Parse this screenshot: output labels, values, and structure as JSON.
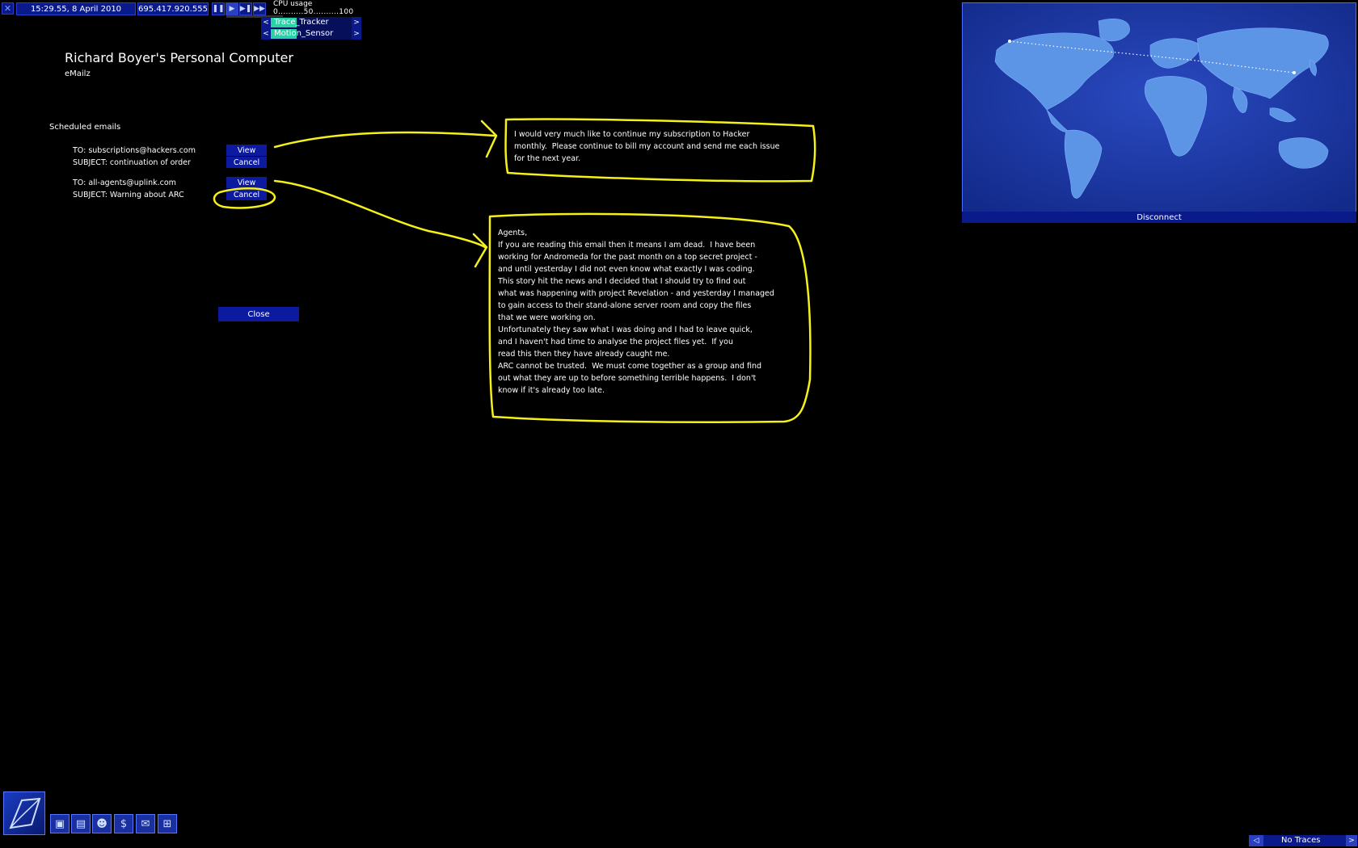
{
  "topbar": {
    "close_icon": "close-icon",
    "datetime": "15:29.55, 8 April 2010",
    "ip": "695.417.920.555",
    "speed_buttons": [
      "pause-icon",
      "play-icon",
      "fast-forward-icon",
      "fastest-forward-icon"
    ],
    "cpu": {
      "label": "CPU usage",
      "scale": "0..........50..........100"
    },
    "gadgets": [
      {
        "name": "Trace_Tracker",
        "prev": "<",
        "next": ">",
        "fill_fraction": 0.32
      },
      {
        "name": "Motion_Sensor",
        "prev": "<",
        "next": ">",
        "fill_fraction": 0.32
      }
    ]
  },
  "screen": {
    "title": "Richard Boyer's Personal Computer",
    "subtitle": "eMailz",
    "scheduled_label": "Scheduled emails",
    "emails": [
      {
        "to": "TO: subscriptions@hackers.com",
        "subject": "SUBJECT: continuation of order",
        "view": "View",
        "cancel": "Cancel"
      },
      {
        "to": "TO: all-agents@uplink.com",
        "subject": "SUBJECT: Warning about ARC",
        "view": "View",
        "cancel": "Cancel"
      }
    ],
    "close_label": "Close"
  },
  "popups": {
    "first": "I would very much like to continue my subscription to Hacker\nmonthly.  Please continue to bill my account and send me each issue\nfor the next year.",
    "second": "Agents,\nIf you are reading this email then it means I am dead.  I have been\nworking for Andromeda for the past month on a top secret project -\nand until yesterday I did not even know what exactly I was coding.\nThis story hit the news and I decided that I should try to find out\nwhat was happening with project Revelation - and yesterday I managed\nto gain access to their stand-alone server room and copy the files\nthat we were working on.\nUnfortunately they saw what I was doing and I had to leave quick,\nand I haven't had time to analyse the project files yet.  If you\nread this then they have already caught me.\nARC cannot be trusted.  We must come together as a group and find\nout what they are up to before something terrible happens.  I don't\nknow if it's already too late."
  },
  "map": {
    "disconnect_label": "Disconnect"
  },
  "bottom": {
    "tools": [
      "computer-icon",
      "storage-icon",
      "agent-icon",
      "finance-icon",
      "email-icon",
      "network-icon"
    ],
    "traces": {
      "label": "No Traces",
      "prev": "◁",
      "next": ">"
    }
  },
  "colors": {
    "accent": "#0c1aa0",
    "annotation": "#f5f01a",
    "map_sea": "#1f3aa8",
    "map_land": "#5c94e6"
  }
}
